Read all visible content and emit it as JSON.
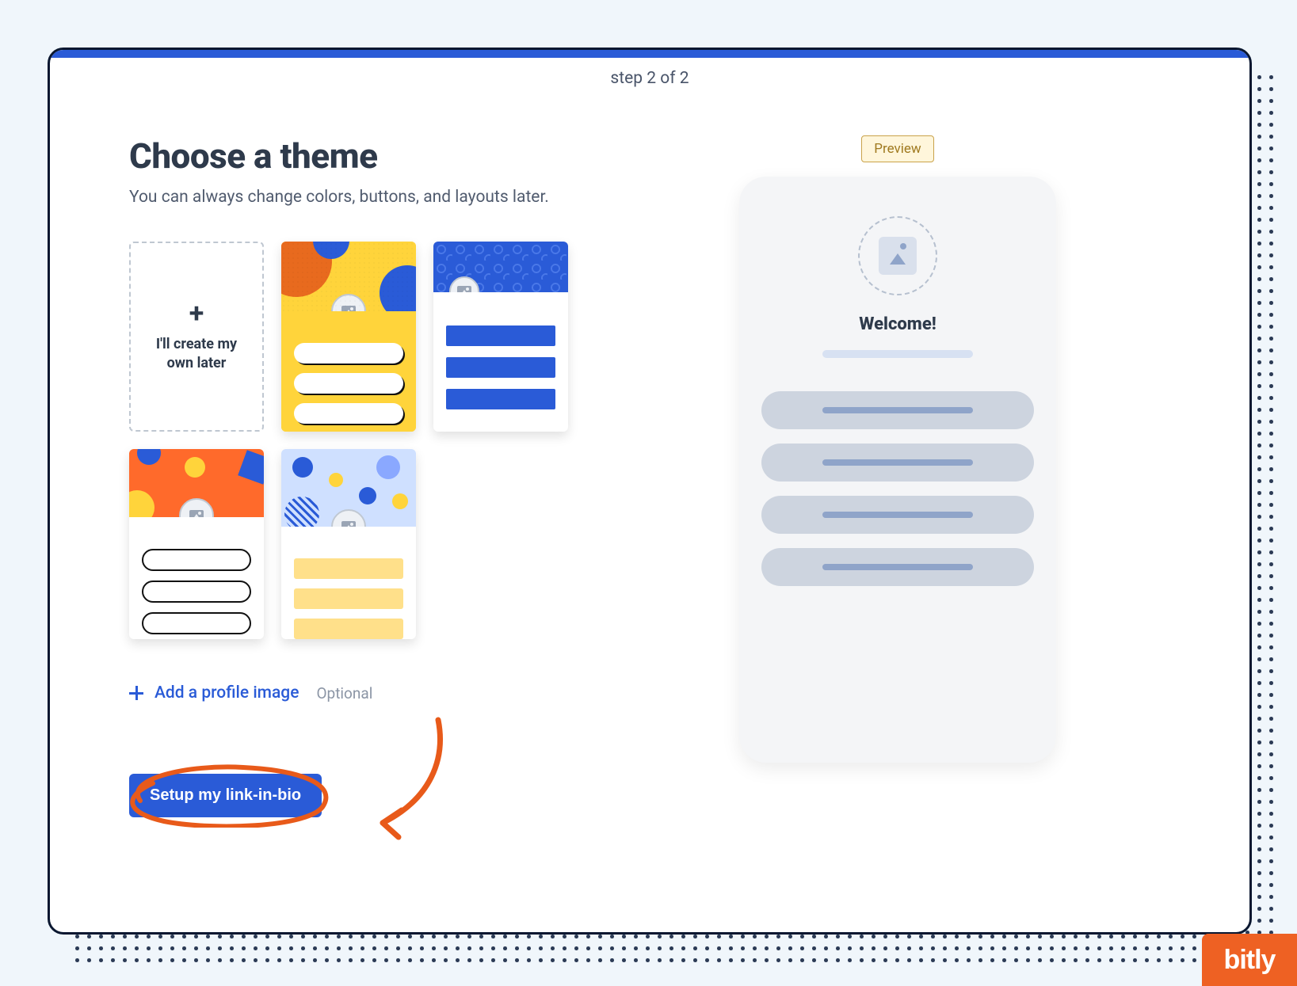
{
  "step_label": "step 2 of 2",
  "heading": "Choose a theme",
  "subtitle": "You can always change colors, buttons, and layouts later.",
  "themes": {
    "own": {
      "plus": "+",
      "label": "I'll create my own later"
    }
  },
  "add_profile": {
    "label": "Add a profile image",
    "optional": "Optional"
  },
  "setup_button": "Setup my link-in-bio",
  "preview": {
    "badge": "Preview",
    "welcome": "Welcome!"
  },
  "brand": "bitly",
  "colors": {
    "accent_blue": "#2a5bd7",
    "accent_orange": "#ee6123",
    "accent_yellow": "#ffd43b"
  }
}
